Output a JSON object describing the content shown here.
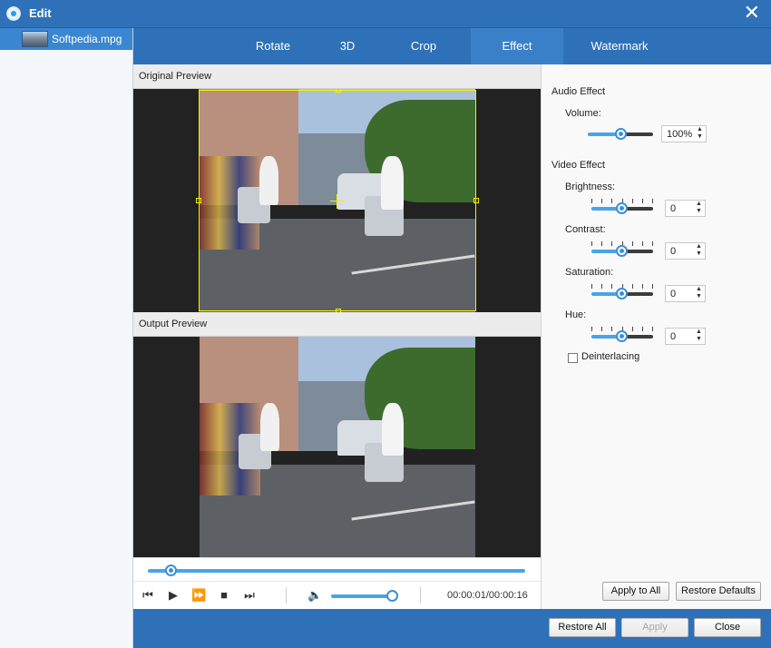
{
  "window": {
    "title": "Edit"
  },
  "file_list": {
    "items": [
      {
        "name": "Softpedia.mpg"
      }
    ]
  },
  "tabs": [
    {
      "label": "Rotate"
    },
    {
      "label": "3D"
    },
    {
      "label": "Crop"
    },
    {
      "label": "Effect",
      "active": true
    },
    {
      "label": "Watermark"
    }
  ],
  "preview": {
    "original_label": "Original Preview",
    "output_label": "Output Preview"
  },
  "playback": {
    "progress_fraction": 0.06,
    "volume_fraction": 0.95,
    "time": "00:00:01/00:00:16"
  },
  "effects": {
    "audio_section": "Audio Effect",
    "volume_label": "Volume:",
    "volume_value": "100%",
    "video_section": "Video Effect",
    "brightness_label": "Brightness:",
    "brightness_value": "0",
    "contrast_label": "Contrast:",
    "contrast_value": "0",
    "saturation_label": "Saturation:",
    "saturation_value": "0",
    "hue_label": "Hue:",
    "hue_value": "0",
    "deinterlacing_label": "Deinterlacing",
    "deinterlacing_checked": false
  },
  "panel_buttons": {
    "apply_to_all": "Apply to All",
    "restore_defaults": "Restore Defaults"
  },
  "footer_buttons": {
    "restore_all": "Restore All",
    "apply": "Apply",
    "close": "Close"
  },
  "colors": {
    "title_bar": "#2e71b8",
    "accent": "#4aa3e8",
    "crop_outline": "#f5f000"
  }
}
